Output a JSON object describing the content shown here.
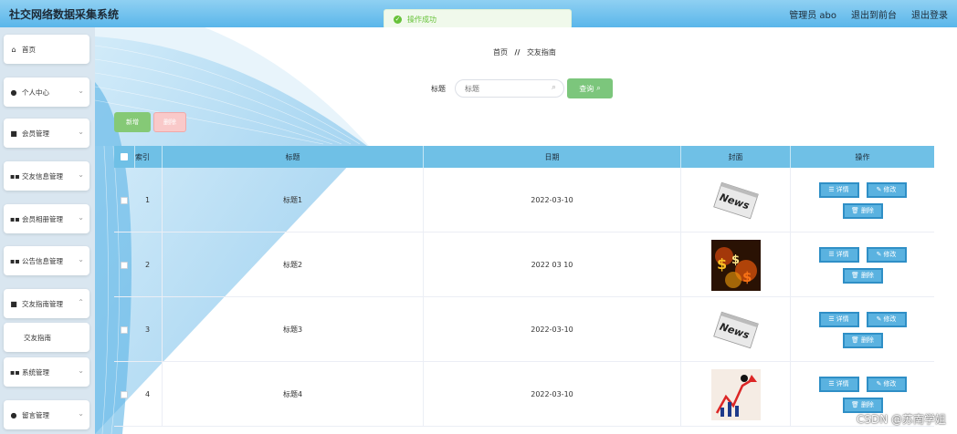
{
  "header": {
    "app_title": "社交网络数据采集系统",
    "links": [
      "管理员 abo",
      "退出到前台",
      "退出登录"
    ]
  },
  "toast": {
    "text": "操作成功",
    "color": "#67c23a"
  },
  "sidebar": {
    "items": [
      {
        "label": "首页",
        "icon": "home-icon",
        "has_chevron": false
      },
      {
        "label": "个人中心",
        "icon": "user-icon",
        "has_chevron": true
      },
      {
        "label": "会员管理",
        "icon": "book-icon",
        "has_chevron": true
      },
      {
        "label": "交友信息管理",
        "icon": "grid-icon",
        "has_chevron": true
      },
      {
        "label": "会员相册管理",
        "icon": "grid-icon",
        "has_chevron": true
      },
      {
        "label": "公告信息管理",
        "icon": "grid-icon",
        "has_chevron": true
      },
      {
        "label": "交友指南管理",
        "icon": "book-icon",
        "has_chevron": true
      },
      {
        "label": "交友指南",
        "icon": "",
        "has_chevron": false,
        "sub": true
      },
      {
        "label": "系统管理",
        "icon": "grid-icon",
        "has_chevron": true
      },
      {
        "label": "留言管理",
        "icon": "pin-icon",
        "has_chevron": true
      }
    ]
  },
  "breadcrumb": {
    "home": "首页",
    "separator": "//",
    "current": "交友指南"
  },
  "search": {
    "label": "标题",
    "placeholder": "标题",
    "button_label": "查询"
  },
  "actions": {
    "add_label": "新增",
    "delete_label": "删除"
  },
  "table": {
    "headers": {
      "index": "索引",
      "title": "标题",
      "date": "日期",
      "cover": "封面",
      "ops": "操作"
    },
    "rows": [
      {
        "index": "1",
        "title": "标题1",
        "date": "2022-03-10",
        "cover": "news-image"
      },
      {
        "index": "2",
        "title": "标题2",
        "date": "2022 03 10",
        "cover": "dollar-fire-image"
      },
      {
        "index": "3",
        "title": "标题3",
        "date": "2022-03-10",
        "cover": "news-image"
      },
      {
        "index": "4",
        "title": "标题4",
        "date": "2022-03-10",
        "cover": "chart-arrow-image"
      }
    ],
    "op_labels": {
      "detail": "详情",
      "edit": "修改",
      "delete": "删除"
    }
  },
  "colors": {
    "accent": "#5ab6ea",
    "header_row": "#6fc0e6",
    "op_button": "#5ab2e0",
    "query_button": "#7cc67c"
  },
  "watermark": "CSDN @苏南学姐"
}
